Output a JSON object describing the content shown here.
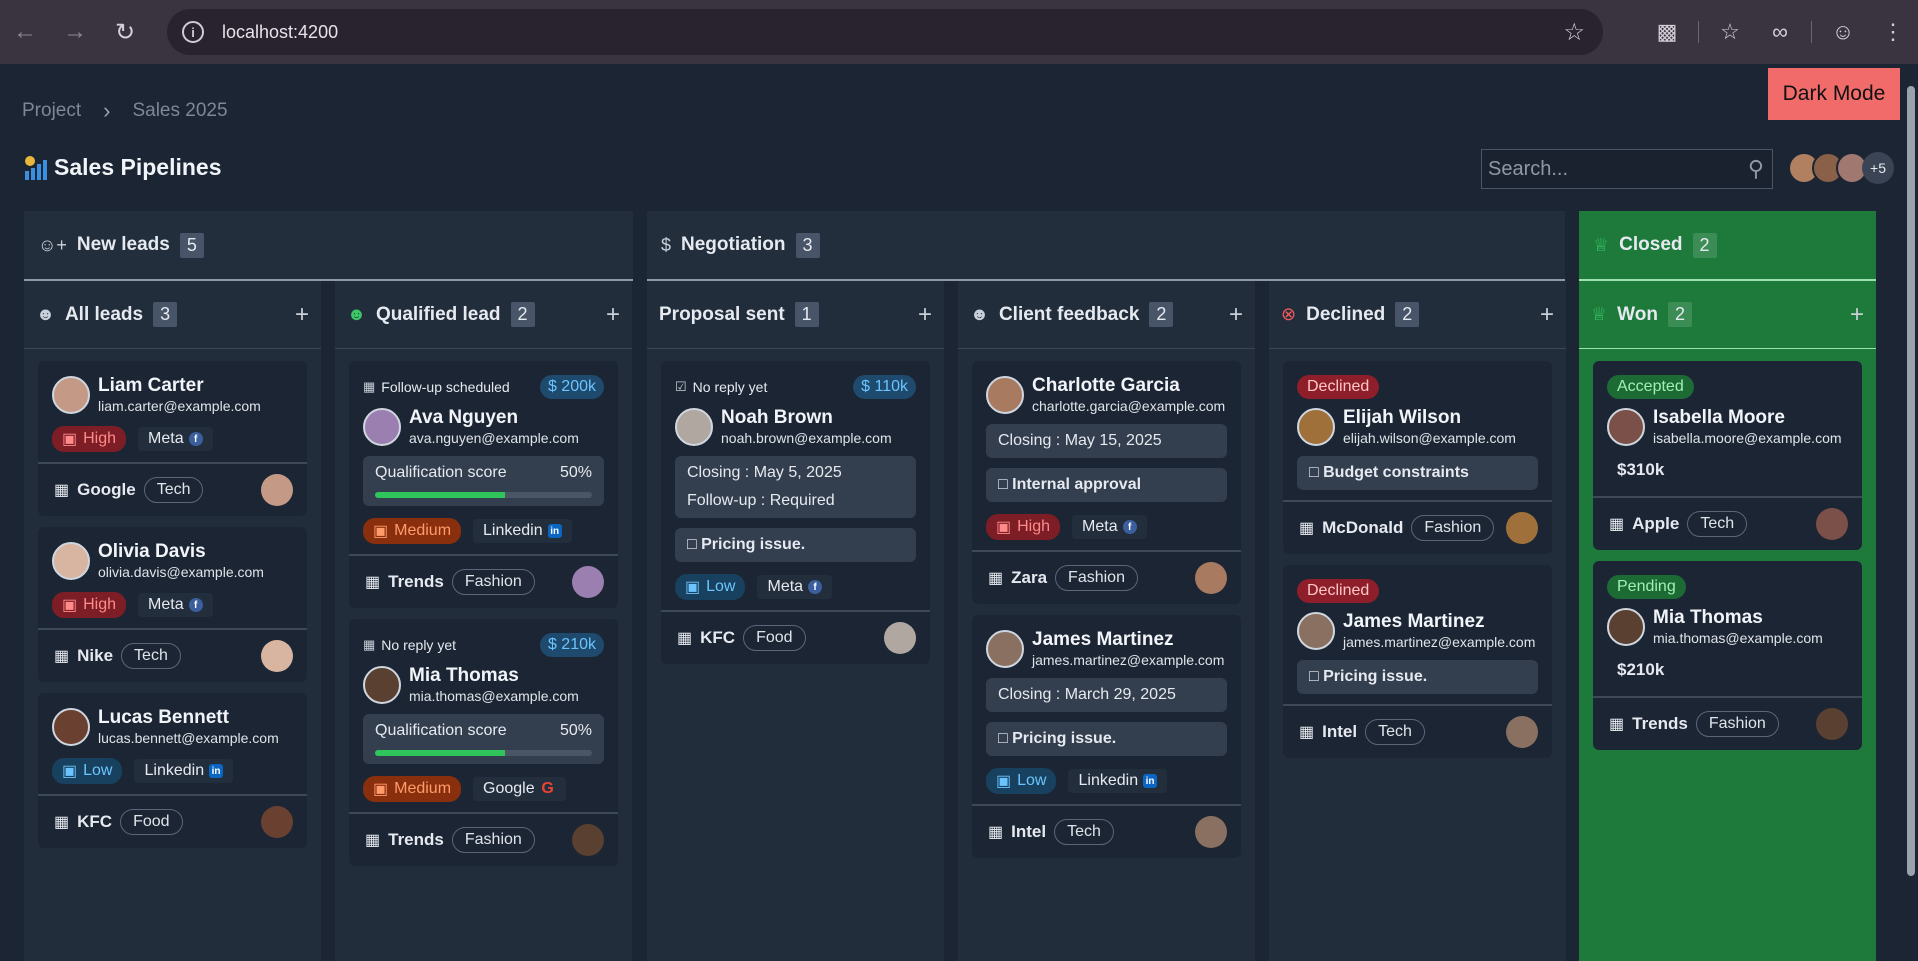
{
  "browser": {
    "url": "localhost:4200"
  },
  "breadcrumb": [
    "Project",
    "Sales 2025"
  ],
  "dark_mode_label": "Dark Mode",
  "page_title": "Sales Pipelines",
  "search": {
    "placeholder": "Search..."
  },
  "team": {
    "more_label": "+5"
  },
  "colors": {
    "accent_green": "#1d7a3a",
    "danger": "#f26b6b",
    "amount": "#6cc4ff"
  },
  "groups": {
    "new_leads": {
      "label": "New leads",
      "count": "5"
    },
    "negotiation": {
      "label": "Negotiation",
      "count": "3"
    },
    "closed": {
      "label": "Closed",
      "count": "2"
    }
  },
  "columns": {
    "all_leads": {
      "label": "All leads",
      "count": "3",
      "cards": [
        {
          "name": "Liam Carter",
          "email": "liam.carter@example.com",
          "priority": "High",
          "source": "Meta",
          "company": "Google",
          "tag": "Tech"
        },
        {
          "name": "Olivia Davis",
          "email": "olivia.davis@example.com",
          "priority": "High",
          "source": "Meta",
          "company": "Nike",
          "tag": "Tech"
        },
        {
          "name": "Lucas Bennett",
          "email": "lucas.bennett@example.com",
          "priority": "Low",
          "source": "Linkedin",
          "company": "KFC",
          "tag": "Food"
        }
      ]
    },
    "qualified_lead": {
      "label": "Qualified lead",
      "count": "2",
      "cards": [
        {
          "status": "Follow-up scheduled",
          "amount": "$ 200k",
          "name": "Ava Nguyen",
          "email": "ava.nguyen@example.com",
          "qual_label": "Qualification score",
          "qual_value": "50%",
          "qual_fraction": 0.6,
          "priority": "Medium",
          "source": "Linkedin",
          "company": "Trends",
          "tag": "Fashion"
        },
        {
          "status": "No reply yet",
          "amount": "$ 210k",
          "name": "Mia Thomas",
          "email": "mia.thomas@example.com",
          "qual_label": "Qualification score",
          "qual_value": "50%",
          "qual_fraction": 0.6,
          "priority": "Medium",
          "source": "Google",
          "company": "Trends",
          "tag": "Fashion"
        }
      ]
    },
    "proposal_sent": {
      "label": "Proposal sent",
      "count": "1",
      "cards": [
        {
          "status": "No reply yet",
          "amount": "$ 110k",
          "name": "Noah Brown",
          "email": "noah.brown@example.com",
          "closing": "Closing : May 5, 2025",
          "followup": "Follow-up : Required",
          "note": "Pricing issue.",
          "priority": "Low",
          "source": "Meta",
          "company": "KFC",
          "tag": "Food"
        }
      ]
    },
    "client_feedback": {
      "label": "Client feedback",
      "count": "2",
      "cards": [
        {
          "name": "Charlotte Garcia",
          "email": "charlotte.garcia@example.com",
          "closing": "Closing : May 15, 2025",
          "note": "Internal approval",
          "priority": "High",
          "source": "Meta",
          "company": "Zara",
          "tag": "Fashion"
        },
        {
          "name": "James Martinez",
          "email": "james.martinez@example.com",
          "closing": "Closing : March 29, 2025",
          "note": "Pricing issue.",
          "priority": "Low",
          "source": "Linkedin",
          "company": "Intel",
          "tag": "Tech"
        }
      ]
    },
    "declined": {
      "label": "Declined",
      "count": "2",
      "cards": [
        {
          "badge": "Declined",
          "name": "Elijah Wilson",
          "email": "elijah.wilson@example.com",
          "note": "Budget constraints",
          "company": "McDonald",
          "tag": "Fashion"
        },
        {
          "badge": "Declined",
          "name": "James Martinez",
          "email": "james.martinez@example.com",
          "note": "Pricing issue.",
          "company": "Intel",
          "tag": "Tech"
        }
      ]
    },
    "won": {
      "label": "Won",
      "count": "2",
      "cards": [
        {
          "badge": "Accepted",
          "name": "Isabella Moore",
          "email": "isabella.moore@example.com",
          "value": "$310k",
          "company": "Apple",
          "tag": "Tech"
        },
        {
          "badge": "Pending",
          "name": "Mia Thomas",
          "email": "mia.thomas@example.com",
          "value": "$210k",
          "company": "Trends",
          "tag": "Fashion"
        }
      ]
    }
  }
}
